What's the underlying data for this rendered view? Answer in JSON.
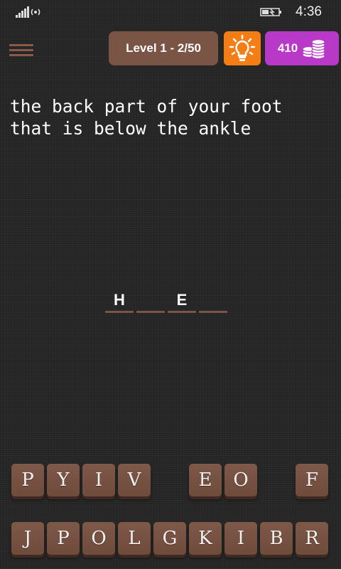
{
  "status": {
    "time": "4:36"
  },
  "header": {
    "level_label": "Level 1 - 2/50",
    "coins": "410"
  },
  "clue": "the back part of your foot\nthat is below the ankle",
  "answer_slots": [
    "H",
    "",
    "E",
    ""
  ],
  "keyboard": {
    "row1": [
      "P",
      "Y",
      "I",
      "V",
      "",
      "E",
      "O",
      "",
      "F"
    ],
    "row2": [
      "J",
      "P",
      "O",
      "L",
      "G",
      "K",
      "I",
      "B",
      "R"
    ]
  },
  "colors": {
    "tile": "#7a5444",
    "hint": "#f57d16",
    "coins": "#b839c7"
  }
}
